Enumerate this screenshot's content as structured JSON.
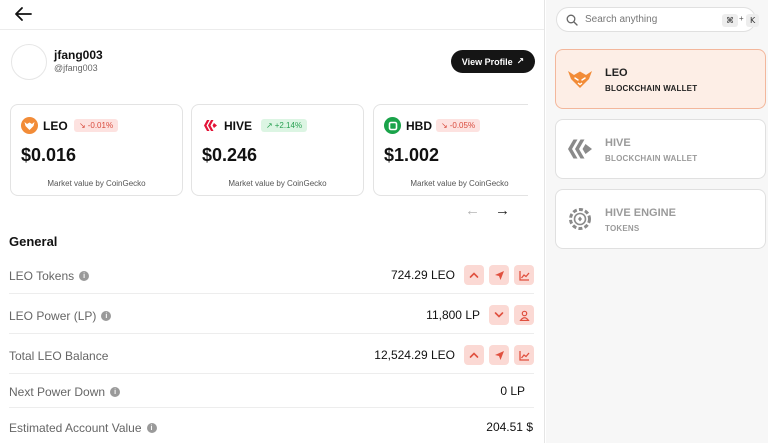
{
  "profile": {
    "username": "jfang003",
    "handle": "@jfang003",
    "view_profile_label": "View Profile",
    "view_profile_arrow": "↗"
  },
  "price_cards": [
    {
      "symbol": "LEO",
      "change": "-0.01%",
      "direction": "down",
      "price": "$0.016",
      "footer": "Market value by CoinGecko",
      "icon_color": "#f28c38"
    },
    {
      "symbol": "HIVE",
      "change": "+2.14%",
      "direction": "up",
      "price": "$0.246",
      "footer": "Market value by CoinGecko",
      "icon_color": "#e31337"
    },
    {
      "symbol": "HBD",
      "change": "-0.05%",
      "direction": "down",
      "price": "$1.002",
      "footer": "Market value by CoinGecko",
      "icon_color": "#1aa34a"
    }
  ],
  "pager": {
    "prev": "←",
    "next": "→"
  },
  "general": {
    "title": "General",
    "rows": [
      {
        "label": "LEO Tokens",
        "value": "724.29 LEO"
      },
      {
        "label": "LEO Power (LP)",
        "value": "11,800 LP"
      },
      {
        "label": "Total LEO Balance",
        "value": "12,524.29 LEO"
      },
      {
        "label": "Next Power Down",
        "value": "0 LP"
      },
      {
        "label": "Estimated Account Value",
        "value": "204.51 $"
      }
    ]
  },
  "search": {
    "placeholder": "Search anything",
    "shortcut_key1": "⌘",
    "shortcut_plus": "+",
    "shortcut_key2": "K"
  },
  "wallets": [
    {
      "name": "LEO",
      "subtitle": "BLOCKCHAIN WALLET",
      "active": true
    },
    {
      "name": "HIVE",
      "subtitle": "BLOCKCHAIN WALLET",
      "active": false
    },
    {
      "name": "HIVE ENGINE",
      "subtitle": "TOKENS",
      "active": false
    }
  ],
  "colors": {
    "accent_orange": "#f28c38",
    "negative": "#d84a3c",
    "positive": "#29a052",
    "action_bg": "#fbd9d4",
    "dark_button": "#151515"
  }
}
